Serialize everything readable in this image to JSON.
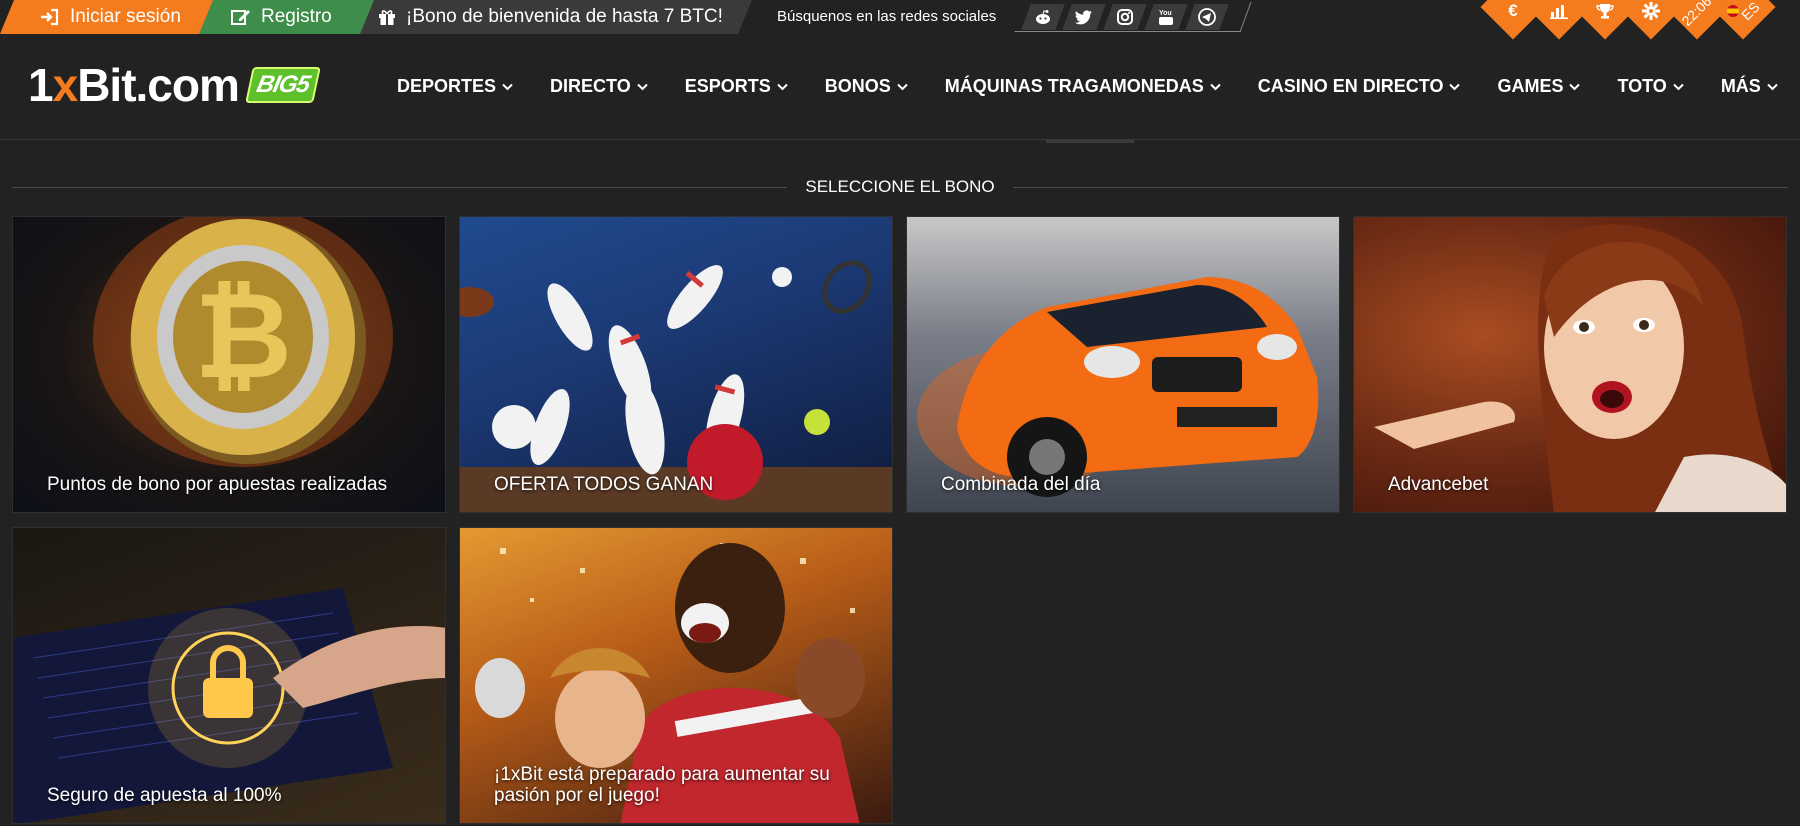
{
  "topbar": {
    "login_label": "Iniciar sesión",
    "register_label": "Registro",
    "bonus_label": "¡Bono de bienvenida de hasta 7 BTC!",
    "social_label": "Búsquenos en las redes sociales",
    "social_icons": [
      "reddit-icon",
      "twitter-icon",
      "instagram-icon",
      "youtube-icon",
      "telegram-icon"
    ]
  },
  "right_panel": {
    "currency_icon": "euro-icon",
    "time": "22:06",
    "language": "ES"
  },
  "header": {
    "logo_text_1": "1",
    "logo_text_x": "x",
    "logo_text_2": "Bit.com",
    "logo_badge": "BIG5",
    "nav": [
      {
        "label": "DEPORTES"
      },
      {
        "label": "DIRECTO"
      },
      {
        "label": "ESPORTS"
      },
      {
        "label": "BONOS"
      },
      {
        "label": "MÁQUINAS TRAGAMONEDAS"
      },
      {
        "label": "CASINO EN DIRECTO"
      },
      {
        "label": "GAMES"
      },
      {
        "label": "TOTO"
      },
      {
        "label": "MÁS"
      }
    ]
  },
  "section": {
    "title": "SELECCIONE EL BONO"
  },
  "cards": [
    {
      "label": "Puntos de bono por apuestas realizadas"
    },
    {
      "label": "OFERTA TODOS GANAN"
    },
    {
      "label": "Combinada del día"
    },
    {
      "label": "Advancebet"
    },
    {
      "label": "Seguro de apuesta al 100%"
    },
    {
      "label": "¡1xBit está preparado para aumentar su pasión por el juego!"
    }
  ],
  "colors": {
    "accent_orange": "#f47c1f",
    "register_green": "#3f8d4a",
    "background": "#222222"
  }
}
